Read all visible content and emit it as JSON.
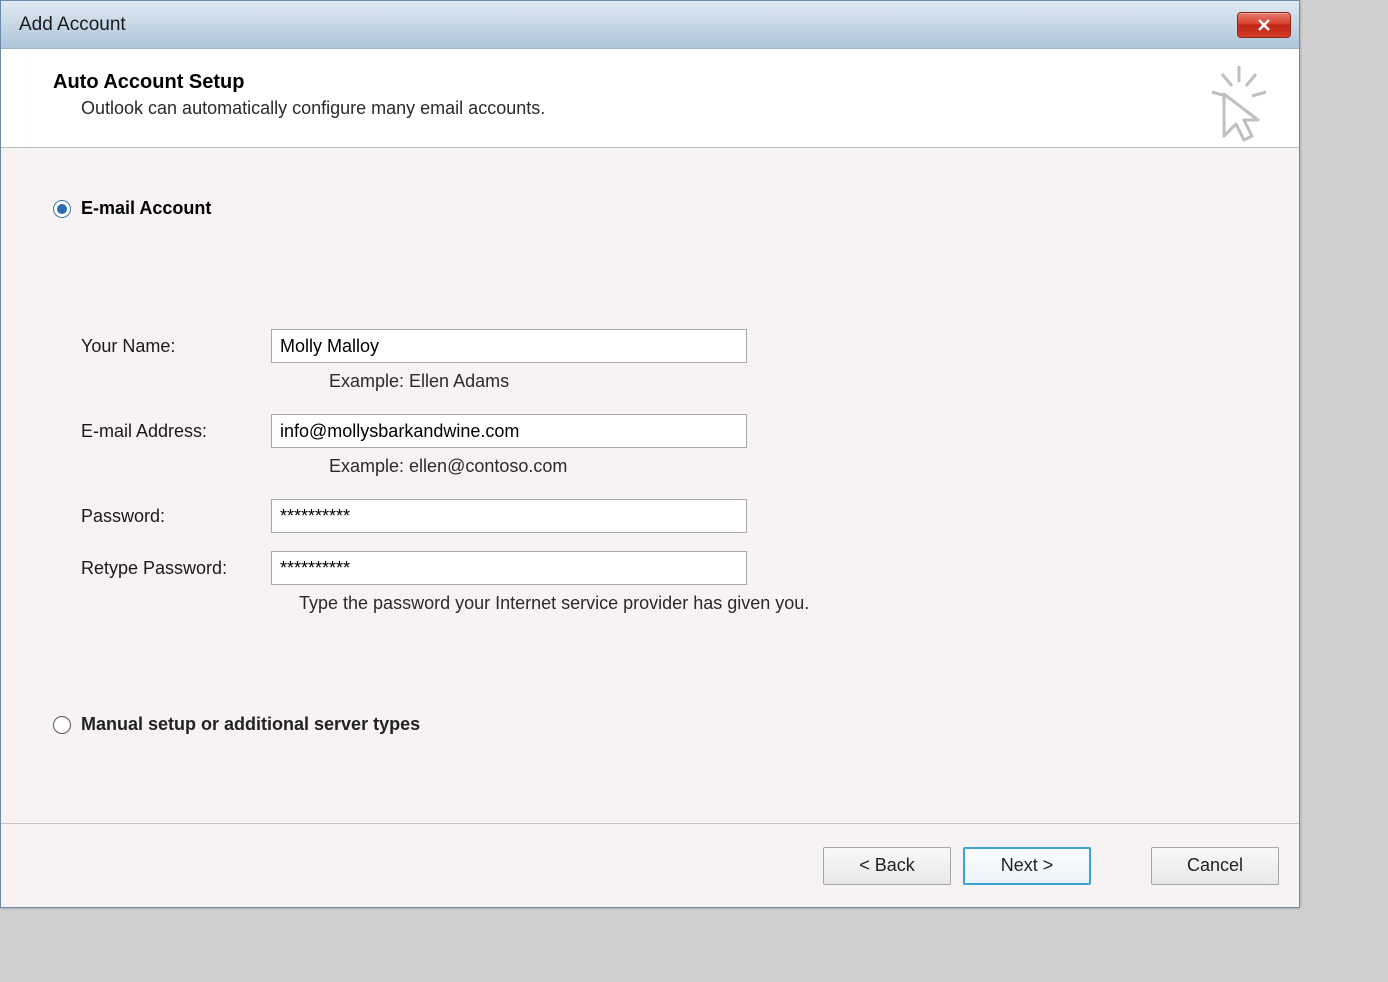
{
  "window": {
    "title": "Add Account"
  },
  "header": {
    "title": "Auto Account Setup",
    "subtitle": "Outlook can automatically configure many email accounts."
  },
  "radio_options": {
    "email_account": "E-mail Account",
    "manual_setup": "Manual setup or additional server types"
  },
  "form": {
    "name_label": "Your Name:",
    "name_value": "Molly Malloy",
    "name_hint": "Example: Ellen Adams",
    "email_label": "E-mail Address:",
    "email_value": "info@mollysbarkandwine.com",
    "email_hint": "Example: ellen@contoso.com",
    "password_label": "Password:",
    "password_value": "**********",
    "retype_label": "Retype Password:",
    "retype_value": "**********",
    "password_hint": "Type the password your Internet service provider has given you."
  },
  "buttons": {
    "back": "< Back",
    "next": "Next >",
    "cancel": "Cancel"
  }
}
